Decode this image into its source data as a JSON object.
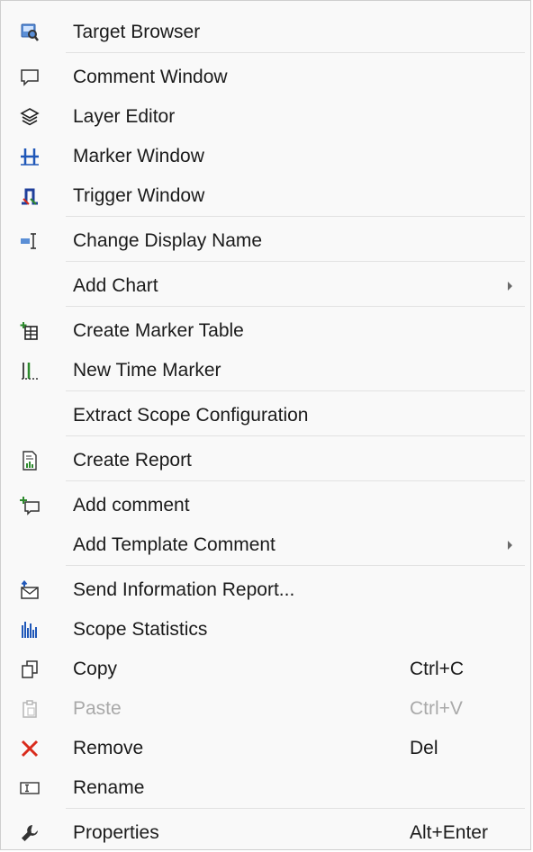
{
  "menu": {
    "items": [
      {
        "label": "Target Browser",
        "icon": "target-browser-icon"
      },
      {
        "label": "Comment Window",
        "icon": "comment-icon"
      },
      {
        "label": "Layer Editor",
        "icon": "layers-icon"
      },
      {
        "label": "Marker Window",
        "icon": "marker-icon"
      },
      {
        "label": "Trigger Window",
        "icon": "trigger-icon"
      },
      {
        "label": "Change Display Name",
        "icon": "rename-display-icon"
      },
      {
        "label": "Add Chart",
        "submenu": true
      },
      {
        "label": "Create Marker Table",
        "icon": "marker-table-icon"
      },
      {
        "label": "New Time Marker",
        "icon": "time-marker-icon"
      },
      {
        "label": "Extract Scope Configuration"
      },
      {
        "label": "Create Report",
        "icon": "report-icon"
      },
      {
        "label": "Add comment",
        "icon": "add-comment-icon"
      },
      {
        "label": "Add Template Comment",
        "submenu": true
      },
      {
        "label": "Send Information Report...",
        "icon": "send-report-icon"
      },
      {
        "label": "Scope Statistics",
        "icon": "statistics-icon"
      },
      {
        "label": "Copy",
        "shortcut": "Ctrl+C",
        "icon": "copy-icon"
      },
      {
        "label": "Paste",
        "shortcut": "Ctrl+V",
        "icon": "paste-icon",
        "disabled": true
      },
      {
        "label": "Remove",
        "shortcut": "Del",
        "icon": "remove-icon"
      },
      {
        "label": "Rename",
        "icon": "rename-icon"
      },
      {
        "label": "Properties",
        "shortcut": "Alt+Enter",
        "icon": "wrench-icon"
      }
    ]
  },
  "colors": {
    "menu_bg": "#f9f9f9",
    "separator": "#e2e2e2",
    "text": "#1b1b1b",
    "disabled_text": "#a9a9a9",
    "accent_blue": "#1f57b8",
    "remove_red": "#d92b1c",
    "add_green": "#2d8a2d"
  }
}
